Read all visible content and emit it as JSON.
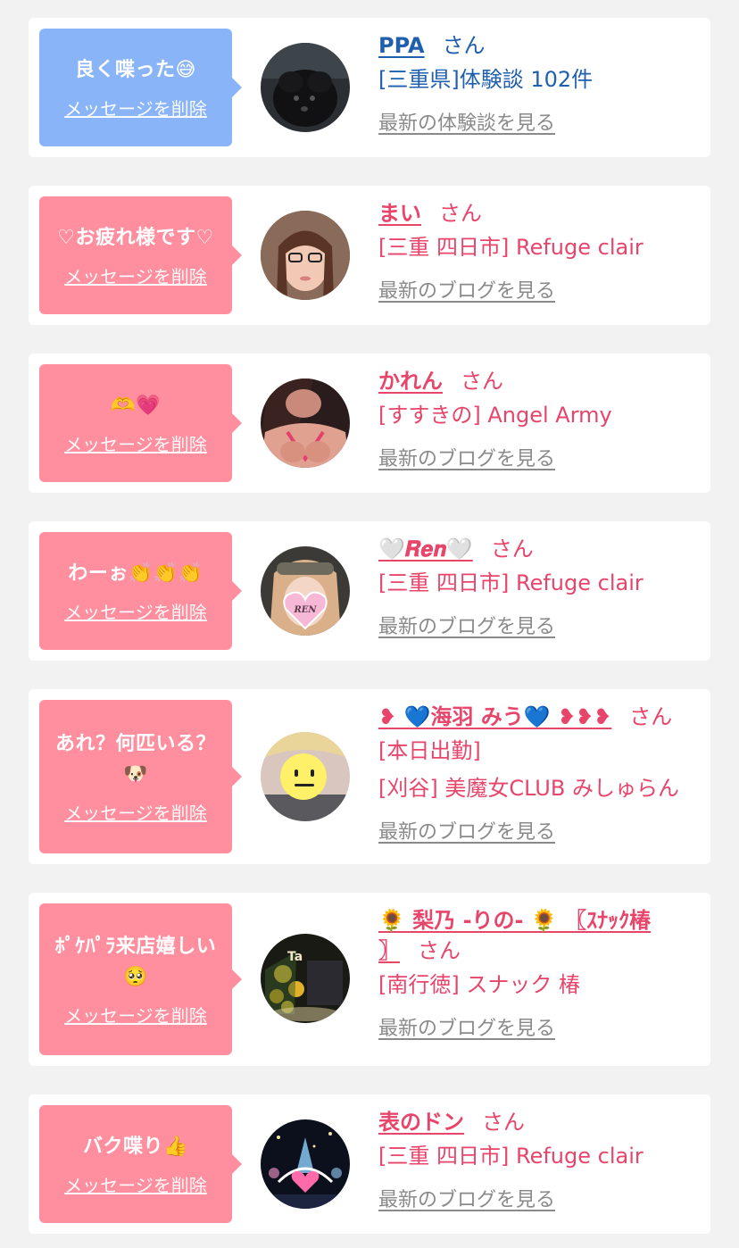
{
  "items": [
    {
      "message": "良く喋った😅",
      "delete_label": "メッセージを削除",
      "name": "PPA",
      "honorific": "さん",
      "lines": [
        "[三重県]体験談 102件"
      ],
      "latest_label": "最新の体験談を見る",
      "bubble_color": "#8ab4f8",
      "text_color": "#1f5fae"
    },
    {
      "message": "♡お疲れ様です♡",
      "delete_label": "メッセージを削除",
      "name": "まい",
      "honorific": "さん",
      "lines": [
        "[三重 四日市] Refuge clair"
      ],
      "latest_label": "最新のブログを見る",
      "bubble_color": "#ff8e9e",
      "text_color": "#e8456b"
    },
    {
      "message": "🫶💗",
      "delete_label": "メッセージを削除",
      "name": "かれん",
      "honorific": "さん",
      "lines": [
        "[すすきの] Angel Army"
      ],
      "latest_label": "最新のブログを見る",
      "bubble_color": "#ff8e9e",
      "text_color": "#e8456b"
    },
    {
      "message": "わーぉ👏👏👏",
      "delete_label": "メッセージを削除",
      "name": "🤍𝑹𝒆𝒏🤍",
      "honorific": "さん",
      "lines": [
        "[三重 四日市] Refuge clair"
      ],
      "latest_label": "最新のブログを見る",
      "bubble_color": "#ff8e9e",
      "text_color": "#e8456b"
    },
    {
      "message_lines": [
        "あれ？何匹いる？",
        "🐶"
      ],
      "delete_label": "メッセージを削除",
      "name": "❥ 💙海羽 みう💙 ❥❥❥",
      "honorific": "さん",
      "lines": [
        "[本日出勤]",
        "[刈谷] 美魔女CLUB みしゅらん"
      ],
      "latest_label": "最新のブログを見る",
      "bubble_color": "#ff8e9e",
      "text_color": "#e8456b"
    },
    {
      "message_lines": [
        "ﾎﾟｹﾊﾟﾗ来店嬉しい",
        "🥺"
      ],
      "delete_label": "メッセージを削除",
      "name_lines": [
        "🌻 梨乃 -りの- 🌻 〖ｽﾅｯｸ椿",
        "〗"
      ],
      "honorific": "さん",
      "lines": [
        "[南行徳] スナック 椿"
      ],
      "latest_label": "最新のブログを見る",
      "bubble_color": "#ff8e9e",
      "text_color": "#e8456b"
    },
    {
      "message": "バク喋り👍",
      "delete_label": "メッセージを削除",
      "name": "表のドン",
      "honorific": "さん",
      "lines": [
        "[三重 四日市] Refuge clair"
      ],
      "latest_label": "最新のブログを見る",
      "bubble_color": "#ff8e9e",
      "text_color": "#e8456b"
    }
  ]
}
